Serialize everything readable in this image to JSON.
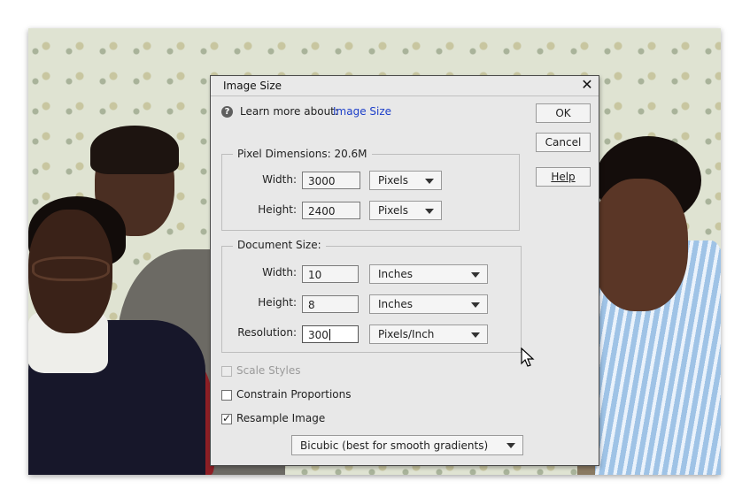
{
  "dialog": {
    "title": "Image Size",
    "close_glyph": "✕",
    "learn_more_label": "Learn more about:",
    "learn_more_link": "Image Size"
  },
  "buttons": {
    "ok": "OK",
    "cancel": "Cancel",
    "help": "Help"
  },
  "pixel_dimensions": {
    "legend": "Pixel Dimensions:  20.6M",
    "width_label": "Width:",
    "width_value": "3000",
    "width_unit": "Pixels",
    "height_label": "Height:",
    "height_value": "2400",
    "height_unit": "Pixels"
  },
  "document_size": {
    "legend": "Document Size:",
    "width_label": "Width:",
    "width_value": "10",
    "width_unit": "Inches",
    "height_label": "Height:",
    "height_value": "8",
    "height_unit": "Inches",
    "resolution_label": "Resolution:",
    "resolution_value": "300",
    "resolution_unit": "Pixels/Inch"
  },
  "options": {
    "scale_styles": {
      "label": "Scale Styles",
      "checked": false,
      "enabled": false
    },
    "constrain_proportions": {
      "label": "Constrain Proportions",
      "checked": false,
      "enabled": true
    },
    "resample_image": {
      "label": "Resample Image",
      "checked": true,
      "enabled": true
    },
    "resample_method": "Bicubic (best for smooth gradients)"
  },
  "icons": {
    "help": "help-circle-icon",
    "close": "close-icon",
    "dropdown": "chevron-down-icon",
    "cursor": "mouse-pointer-icon"
  }
}
